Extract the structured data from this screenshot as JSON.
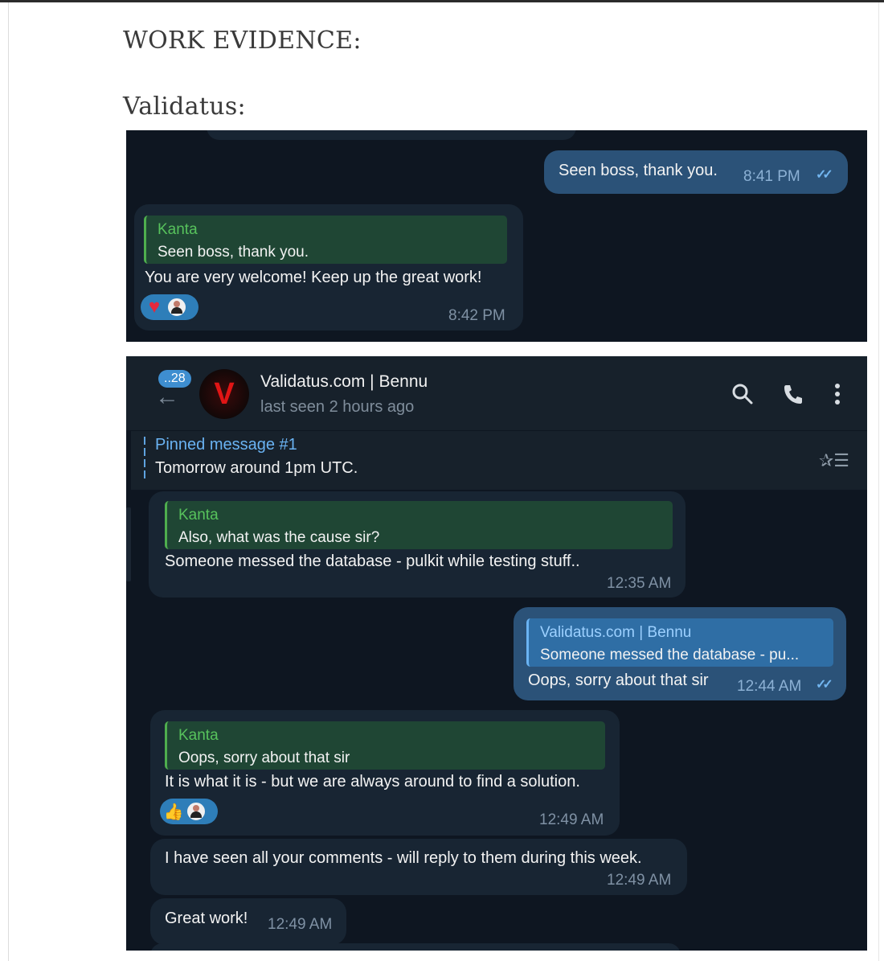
{
  "document": {
    "heading": "WORK EVIDENCE:",
    "subheading": "Validatus:"
  },
  "screenshot1": {
    "outgoing": {
      "text": "Seen boss, thank you.",
      "time": "8:41 PM",
      "ticks": "✓✓"
    },
    "incoming": {
      "reply_name": "Kanta",
      "reply_text": "Seen boss, thank you.",
      "text": "You are very welcome! Keep up the great work!",
      "reactions": [
        "heart",
        "avatar"
      ],
      "time": "8:42 PM"
    }
  },
  "screenshot2": {
    "header": {
      "unread_count": "..28",
      "avatar_letter": "V",
      "title": "Validatus.com | Bennu",
      "status": "last seen 2 hours ago",
      "icons": [
        "back-arrow-icon",
        "search-icon",
        "phone-icon",
        "more-vertical-icon"
      ]
    },
    "pinned": {
      "title": "Pinned message #1",
      "text": "Tomorrow around 1pm UTC."
    },
    "messages": [
      {
        "reply_name": "Kanta",
        "reply_text": "Also, what was the cause sir?",
        "text": "Someone messed the database - pulkit while testing stuff..",
        "time": "12:35 AM"
      },
      {
        "reply_name": "Validatus.com | Bennu",
        "reply_text": "Someone messed the database - pu...",
        "text": "Oops, sorry about that sir",
        "time": "12:44 AM",
        "ticks": "✓✓"
      },
      {
        "reply_name": "Kanta",
        "reply_text": "Oops, sorry about that sir",
        "text": "It is what it is - but we are always around to find a solution.",
        "reactions": [
          "thumbs-up",
          "avatar"
        ],
        "time": "12:49 AM"
      },
      {
        "text": "I have seen all your comments - will reply to them during this week.",
        "time": "12:49 AM"
      },
      {
        "text": "Great work!",
        "time": "12:49 AM"
      }
    ]
  },
  "colors": {
    "chat_background": "#0e1621",
    "incoming_bubble": "#182533",
    "outgoing_bubble": "#2b5278",
    "reply_accent": "#4fae4e",
    "link_blue": "#6ab3f3"
  }
}
